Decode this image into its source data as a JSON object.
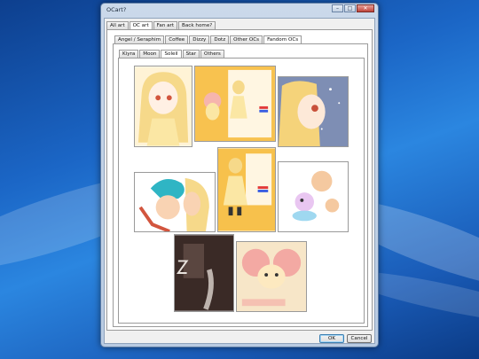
{
  "window": {
    "title": "OCart?"
  },
  "top_tabs": [
    "All art",
    "OC art",
    "Fan art",
    "Back home?"
  ],
  "category_tabs": [
    "Angel / Seraphim",
    "Coffee",
    "Dizzy",
    "Dotz",
    "Other OCs",
    "Fandom OCs"
  ],
  "character_tabs": [
    "Kiyra",
    "Moon",
    "Soleil",
    "Star",
    "Others"
  ],
  "gallery": [
    {
      "name": "soleil-portrait",
      "colors": [
        "#fff3d6",
        "#f6d98a"
      ]
    },
    {
      "name": "soleil-reference-sheet",
      "colors": [
        "#f8c24f",
        "#fce8a8"
      ]
    },
    {
      "name": "soleil-closeup",
      "colors": [
        "#7e8eb4",
        "#f5d37a"
      ]
    },
    {
      "name": "soleil-with-blue-hair-friend",
      "colors": [
        "#ffffff",
        "#2fb5c4"
      ]
    },
    {
      "name": "soleil-outfit-sheet",
      "colors": [
        "#f7c14c",
        "#fbe7a4"
      ]
    },
    {
      "name": "soleil-creature-ref",
      "colors": [
        "#ffffff",
        "#f5c9a0"
      ]
    },
    {
      "name": "soleil-dark-sketch",
      "colors": [
        "#3a2a26",
        "#5a4640"
      ]
    },
    {
      "name": "soleil-creature-card",
      "colors": [
        "#f7c7c7",
        "#f3a9a3"
      ]
    }
  ],
  "buttons": {
    "ok": "OK",
    "cancel": "Cancel"
  },
  "colors": {
    "accent": "#3c7fb1",
    "desktop": "#1b66c6"
  }
}
